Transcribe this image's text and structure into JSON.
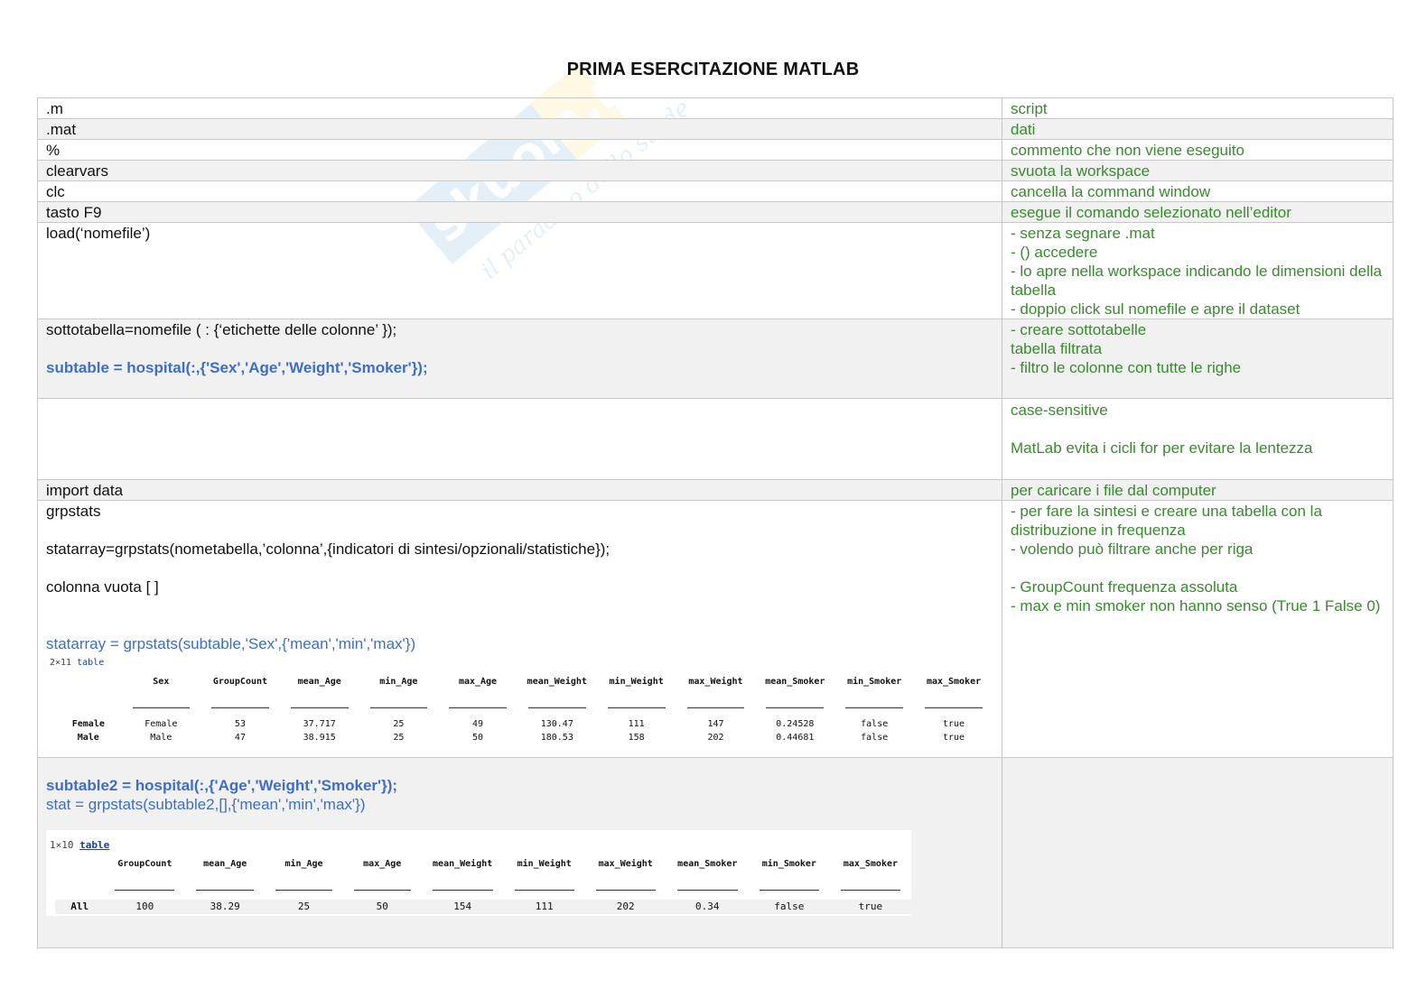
{
  "title": "PRIMA ESERCITAZIONE MATLAB",
  "watermark": {
    "brand": "skuola.net",
    "tagline": "il paradiso dello studente"
  },
  "rows": [
    {
      "left": ".m",
      "right": [
        "script"
      ]
    },
    {
      "left": ".mat",
      "right": [
        "dati"
      ]
    },
    {
      "left": "%",
      "right": [
        "commento che non viene eseguito"
      ]
    },
    {
      "left": "clearvars",
      "right": [
        "svuota la workspace"
      ]
    },
    {
      "left": "clc",
      "right": [
        "cancella la command window"
      ]
    },
    {
      "left": "tasto F9",
      "right": [
        "esegue il comando selezionato nell’editor"
      ]
    },
    {
      "left": "load(‘nomefile’)",
      "right": [
        "- senza segnare .mat",
        "- () accedere",
        "- lo apre nella workspace indicando le dimensioni della tabella",
        "- doppio click sul nomefile e apre il dataset"
      ]
    }
  ],
  "sub": {
    "syntax": "sottotabella=nomefile ( : {‘etichette delle colonne’ });",
    "example": "subtable = hospital(:,{'Sex','Age','Weight','Smoker'});",
    "right": [
      "- creare sottotabelle",
      "tabella filtrata",
      "- filtro le colonne con tutte le righe"
    ]
  },
  "notes": {
    "case": "case-sensitive",
    "loops": "MatLab evita i cicli for per evitare la lentezza"
  },
  "import": {
    "left": "import data",
    "right": "per caricare i file dal computer"
  },
  "grp": {
    "name": "grpstats",
    "syntax": "statarray=grpstats(nometabella,’colonna’,{indicatori di sintesi/opzionali/statistiche});",
    "empty": "colonna vuota [ ]",
    "example": "statarray = grpstats(subtable,'Sex',{'mean','min','max'})",
    "right1": [
      "- per fare la sintesi e creare una tabella con la distribuzione in frequenza",
      "- volendo può filtrare anche per riga"
    ],
    "right2": [
      "- GroupCount frequenza assoluta",
      "- max e min smoker non hanno senso (True 1 False 0)"
    ],
    "result": {
      "size_label": "2×11",
      "table_word": "table",
      "headers": [
        "",
        "Sex",
        "GroupCount",
        "mean_Age",
        "min_Age",
        "max_Age",
        "mean_Weight",
        "min_Weight",
        "max_Weight",
        "mean_Smoker",
        "min_Smoker",
        "max_Smoker"
      ],
      "rows": [
        [
          "Female",
          "Female",
          "53",
          "37.717",
          "25",
          "49",
          "130.47",
          "111",
          "147",
          "0.24528",
          "false",
          "true"
        ],
        [
          "Male",
          "Male",
          "47",
          "38.915",
          "25",
          "50",
          "180.53",
          "158",
          "202",
          "0.44681",
          "false",
          "true"
        ]
      ]
    }
  },
  "sub2": {
    "line1": "subtable2 = hospital(:,{'Age','Weight','Smoker'});",
    "line2": "stat = grpstats(subtable2,[],{'mean','min','max'})",
    "result": {
      "size_label": "1×10",
      "table_word": "table",
      "headers": [
        "",
        "GroupCount",
        "mean_Age",
        "min_Age",
        "max_Age",
        "mean_Weight",
        "min_Weight",
        "max_Weight",
        "mean_Smoker",
        "min_Smoker",
        "max_Smoker"
      ],
      "rows": [
        [
          "All",
          "100",
          "38.29",
          "25",
          "50",
          "154",
          "111",
          "202",
          "0.34",
          "false",
          "true"
        ]
      ]
    }
  }
}
